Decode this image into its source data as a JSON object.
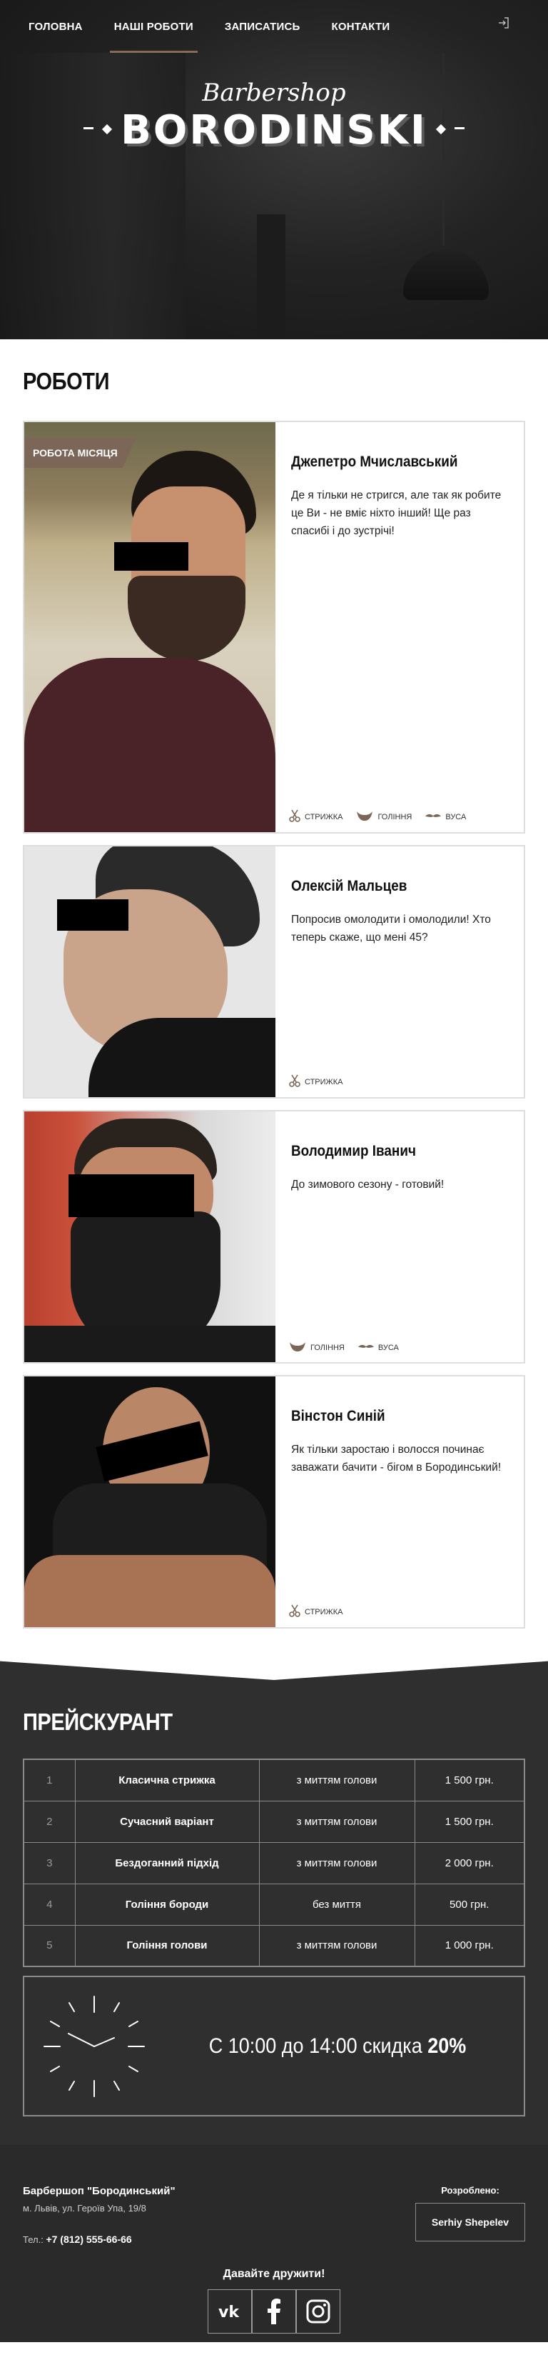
{
  "nav": {
    "items": [
      {
        "label": "ГОЛОВНА",
        "active": false
      },
      {
        "label": "НАШІ РОБОТИ",
        "active": true
      },
      {
        "label": "ЗАПИСАТИСЬ",
        "active": false
      },
      {
        "label": "КОНТАКТИ",
        "active": false
      }
    ],
    "login_icon": "sign-in-icon"
  },
  "hero": {
    "logo_script": "Barbershop",
    "logo_main": "BORODINSKI"
  },
  "works": {
    "title": "РОБОТИ",
    "badge": "РОБОТА МІСЯЦЯ",
    "cards": [
      {
        "name": "Джепетро Мчиславський",
        "quote": "Де я тільки не стригся, але так як робите це Ви - не вміє ніхто інший! Ще раз спасибі і до зустрічі!",
        "tags": [
          {
            "icon": "scissors-icon",
            "label": "СТРИЖКА"
          },
          {
            "icon": "beard-icon",
            "label": "ГОЛІННЯ"
          },
          {
            "icon": "mustache-icon",
            "label": "ВУСА"
          }
        ]
      },
      {
        "name": "Олексій Мальцев",
        "quote": "Попросив омолодити і омолодили! Хто теперь скаже, що мені 45?",
        "tags": [
          {
            "icon": "scissors-icon",
            "label": "СТРИЖКА"
          }
        ]
      },
      {
        "name": "Володимир Іванич",
        "quote": "До зимового сезону - готовий!",
        "tags": [
          {
            "icon": "beard-icon",
            "label": "ГОЛІННЯ"
          },
          {
            "icon": "mustache-icon",
            "label": "ВУСА"
          }
        ]
      },
      {
        "name": "Вінстон Синій",
        "quote": "Як тільки заростаю і волосся починає заважати бачити - бігом в Бородинський!",
        "tags": [
          {
            "icon": "scissors-icon",
            "label": "СТРИЖКА"
          }
        ]
      }
    ]
  },
  "prices": {
    "title": "ПРЕЙСКУРАНТ",
    "rows": [
      {
        "num": "1",
        "service": "Класична стрижка",
        "note": "з миттям голови",
        "price": "1 500 грн."
      },
      {
        "num": "2",
        "service": "Сучасний варіант",
        "note": "з миттям голови",
        "price": "1 500 грн."
      },
      {
        "num": "3",
        "service": "Бездоганний підхід",
        "note": "з миттям голови",
        "price": "2 000 грн."
      },
      {
        "num": "4",
        "service": "Гоління бороди",
        "note": "без миття",
        "price": "500 грн."
      },
      {
        "num": "5",
        "service": "Гоління голови",
        "note": "з миттям голови",
        "price": "1 000 грн."
      }
    ],
    "discount_text": "С 10:00 до 14:00 скидка",
    "discount_value": "20%",
    "clock_icon": "clock-icon"
  },
  "footer": {
    "name": "Барбершоп \"Бородинський\"",
    "address": "м. Львів, ул. Героїв Упа, 19/8",
    "tel_label": "Тел.:",
    "tel": "+7 (812) 555-66-66",
    "dev_label": "Розроблено:",
    "dev_name": "Serhiy Shepelev",
    "friends": "Давайте дружити!",
    "socials": [
      "vk-icon",
      "facebook-icon",
      "instagram-icon"
    ]
  },
  "colors": {
    "accent": "#7b6657",
    "dark": "#2f2f2f",
    "border": "#8a8a8a"
  }
}
